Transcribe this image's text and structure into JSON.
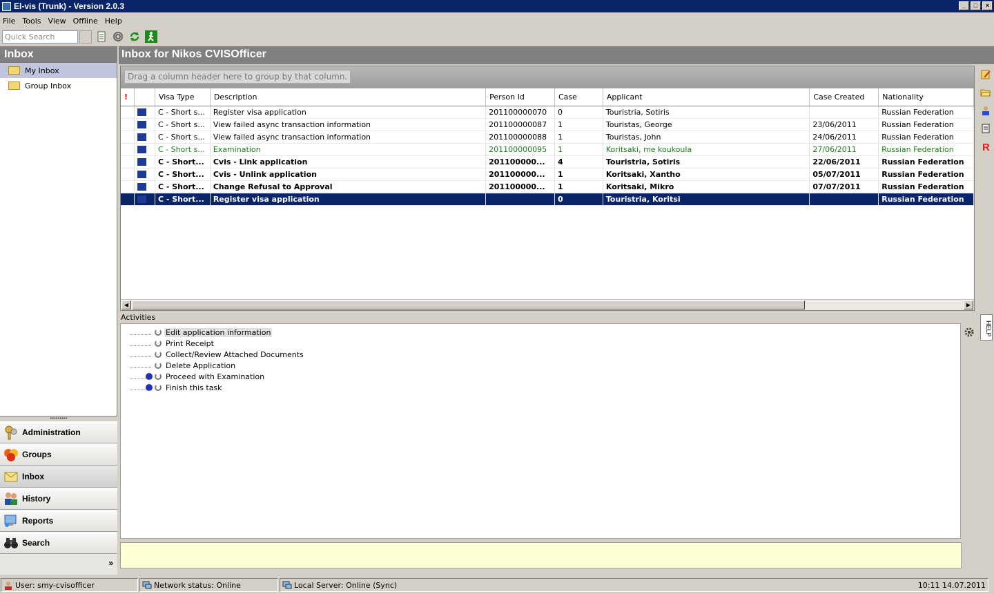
{
  "window": {
    "title": "El-vis (Trunk) - Version 2.0.3",
    "min": "_",
    "max": "□",
    "close": "×"
  },
  "menu": [
    "File",
    "Tools",
    "View",
    "Offline",
    "Help"
  ],
  "toolbar": {
    "quick_search_placeholder": "Quick Search"
  },
  "left": {
    "title": "Inbox",
    "tree": [
      "My Inbox",
      "Group Inbox"
    ],
    "nav": [
      "Administration",
      "Groups",
      "Inbox",
      "History",
      "Reports",
      "Search"
    ],
    "more": "»"
  },
  "main": {
    "title": "Inbox for Nikos CVISOfficer",
    "group_hint": "Drag a column header here to group by that column.",
    "columns": [
      "!",
      "",
      "Visa Type",
      "Description",
      "Person Id",
      "Case",
      "Applicant",
      "Case Created",
      "Nationality"
    ],
    "rows": [
      {
        "style": "",
        "visa": "C - Short s...",
        "desc": "Register visa application",
        "pid": "201100000070",
        "case": "0",
        "applicant": "Touristria, Sotiris",
        "created": "",
        "nat": "Russian Federation"
      },
      {
        "style": "",
        "visa": "C - Short s...",
        "desc": "View failed async transaction information",
        "pid": "201100000087",
        "case": "1",
        "applicant": "Touristas, George",
        "created": "23/06/2011",
        "nat": "Russian Federation"
      },
      {
        "style": "",
        "visa": "C - Short s...",
        "desc": "View failed async transaction information",
        "pid": "201100000088",
        "case": "1",
        "applicant": "Touristas, John",
        "created": "24/06/2011",
        "nat": "Russian Federation"
      },
      {
        "style": "green",
        "visa": "C - Short s...",
        "desc": "Examination",
        "pid": "201100000095",
        "case": "1",
        "applicant": "Koritsaki, me koukoula",
        "created": "27/06/2011",
        "nat": "Russian Federation"
      },
      {
        "style": "bold",
        "visa": "C - Short...",
        "desc": "Cvis - Link application",
        "pid": "201100000...",
        "case": "4",
        "applicant": "Touristria, Sotiris",
        "created": "22/06/2011",
        "nat": "Russian Federation"
      },
      {
        "style": "bold",
        "visa": "C - Short...",
        "desc": "Cvis - Unlink application",
        "pid": "201100000...",
        "case": "1",
        "applicant": "Koritsaki, Xantho",
        "created": "05/07/2011",
        "nat": "Russian Federation"
      },
      {
        "style": "bold",
        "visa": "C - Short...",
        "desc": "Change Refusal to Approval",
        "pid": "201100000...",
        "case": "1",
        "applicant": "Koritsaki, Mikro",
        "created": "07/07/2011",
        "nat": "Russian Federation"
      },
      {
        "style": "sel",
        "visa": "C - Short...",
        "desc": "Register visa application",
        "pid": "",
        "case": "0",
        "applicant": "Touristria, Koritsi",
        "created": "",
        "nat": "Russian Federation"
      }
    ]
  },
  "activities": {
    "label": "Activities",
    "items": [
      {
        "text": "Edit application information",
        "go": false
      },
      {
        "text": "Print Receipt",
        "go": false
      },
      {
        "text": "Collect/Review Attached Documents",
        "go": false
      },
      {
        "text": "Delete Application",
        "go": false
      },
      {
        "text": "Proceed with Examination",
        "go": true
      },
      {
        "text": "Finish this task",
        "go": true
      }
    ],
    "help_tab": "HELP"
  },
  "status": {
    "user": "User: smy-cvisofficer",
    "network": "Network status: Online",
    "server": "Local Server:  Online (Sync)",
    "clock": "10:11 14.07.2011"
  },
  "colors": {
    "title_bar": "#0a246a",
    "selection": "#0a246a",
    "green_row": "#1e7b1e",
    "notes_bg": "#ffffd4"
  }
}
